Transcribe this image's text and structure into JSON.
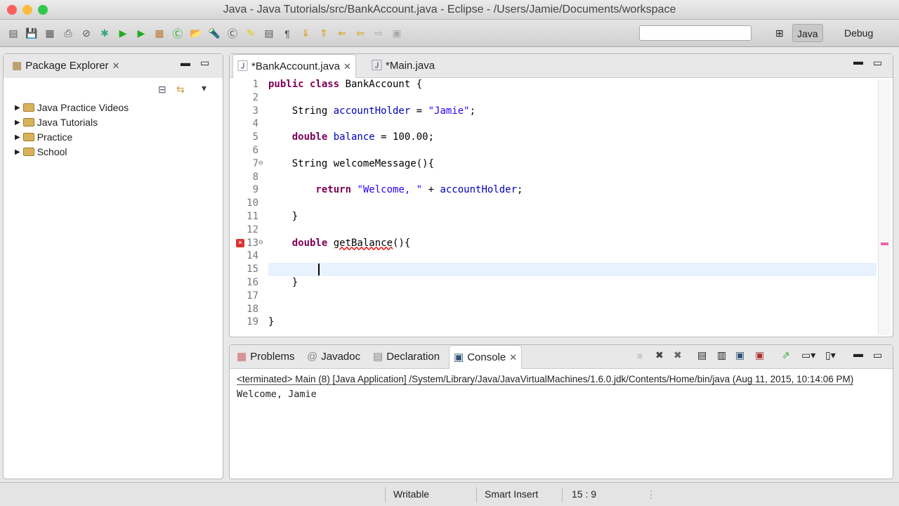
{
  "window": {
    "title": "Java - Java Tutorials/src/BankAccount.java - Eclipse - /Users/Jamie/Documents/workspace"
  },
  "toolbar": {
    "perspectives": [
      {
        "label": "Java",
        "active": true
      },
      {
        "label": "Debug",
        "active": false
      }
    ],
    "search_value": ""
  },
  "package_explorer": {
    "title": "Package Explorer",
    "projects": [
      "Java Practice Videos",
      "Java Tutorials",
      "Practice",
      "School"
    ]
  },
  "editor": {
    "tabs": [
      {
        "label": "*BankAccount.java",
        "active": true
      },
      {
        "label": "*Main.java",
        "active": false
      }
    ],
    "lines": [
      [
        {
          "t": "public class ",
          "c": "kw"
        },
        {
          "t": "BankAccount {",
          "c": ""
        }
      ],
      [],
      [
        {
          "t": "    String ",
          "c": ""
        },
        {
          "t": "accountHolder",
          "c": "fd"
        },
        {
          "t": " = ",
          "c": ""
        },
        {
          "t": "\"Jamie\"",
          "c": "st"
        },
        {
          "t": ";",
          "c": ""
        }
      ],
      [],
      [
        {
          "t": "    double ",
          "c": "kw"
        },
        {
          "t": "balance",
          "c": "fd"
        },
        {
          "t": " = 100.00;",
          "c": ""
        }
      ],
      [],
      [
        {
          "t": "    String welcomeMessage(){",
          "c": ""
        }
      ],
      [],
      [
        {
          "t": "        return ",
          "c": "kw"
        },
        {
          "t": "\"Welcome, \"",
          "c": "st"
        },
        {
          "t": " + ",
          "c": ""
        },
        {
          "t": "accountHolder",
          "c": "fd"
        },
        {
          "t": ";",
          "c": ""
        }
      ],
      [],
      [
        {
          "t": "    }",
          "c": ""
        }
      ],
      [],
      [
        {
          "t": "    double ",
          "c": "kw"
        },
        {
          "t": "getBalance",
          "c": "err"
        },
        {
          "t": "(){",
          "c": ""
        }
      ],
      [],
      [],
      [
        {
          "t": "    }",
          "c": ""
        }
      ],
      [],
      [],
      [
        {
          "t": "}",
          "c": ""
        }
      ]
    ],
    "current_line": 15
  },
  "console_panel": {
    "tabs": [
      "Problems",
      "Javadoc",
      "Declaration",
      "Console"
    ],
    "active_tab": "Console",
    "header": "<terminated> Main (8) [Java Application] /System/Library/Java/JavaVirtualMachines/1.6.0.jdk/Contents/Home/bin/java (Aug 11, 2015, 10:14:06 PM)",
    "output": "Welcome, Jamie"
  },
  "status": {
    "writable": "Writable",
    "insert_mode": "Smart Insert",
    "position": "15 : 9"
  }
}
